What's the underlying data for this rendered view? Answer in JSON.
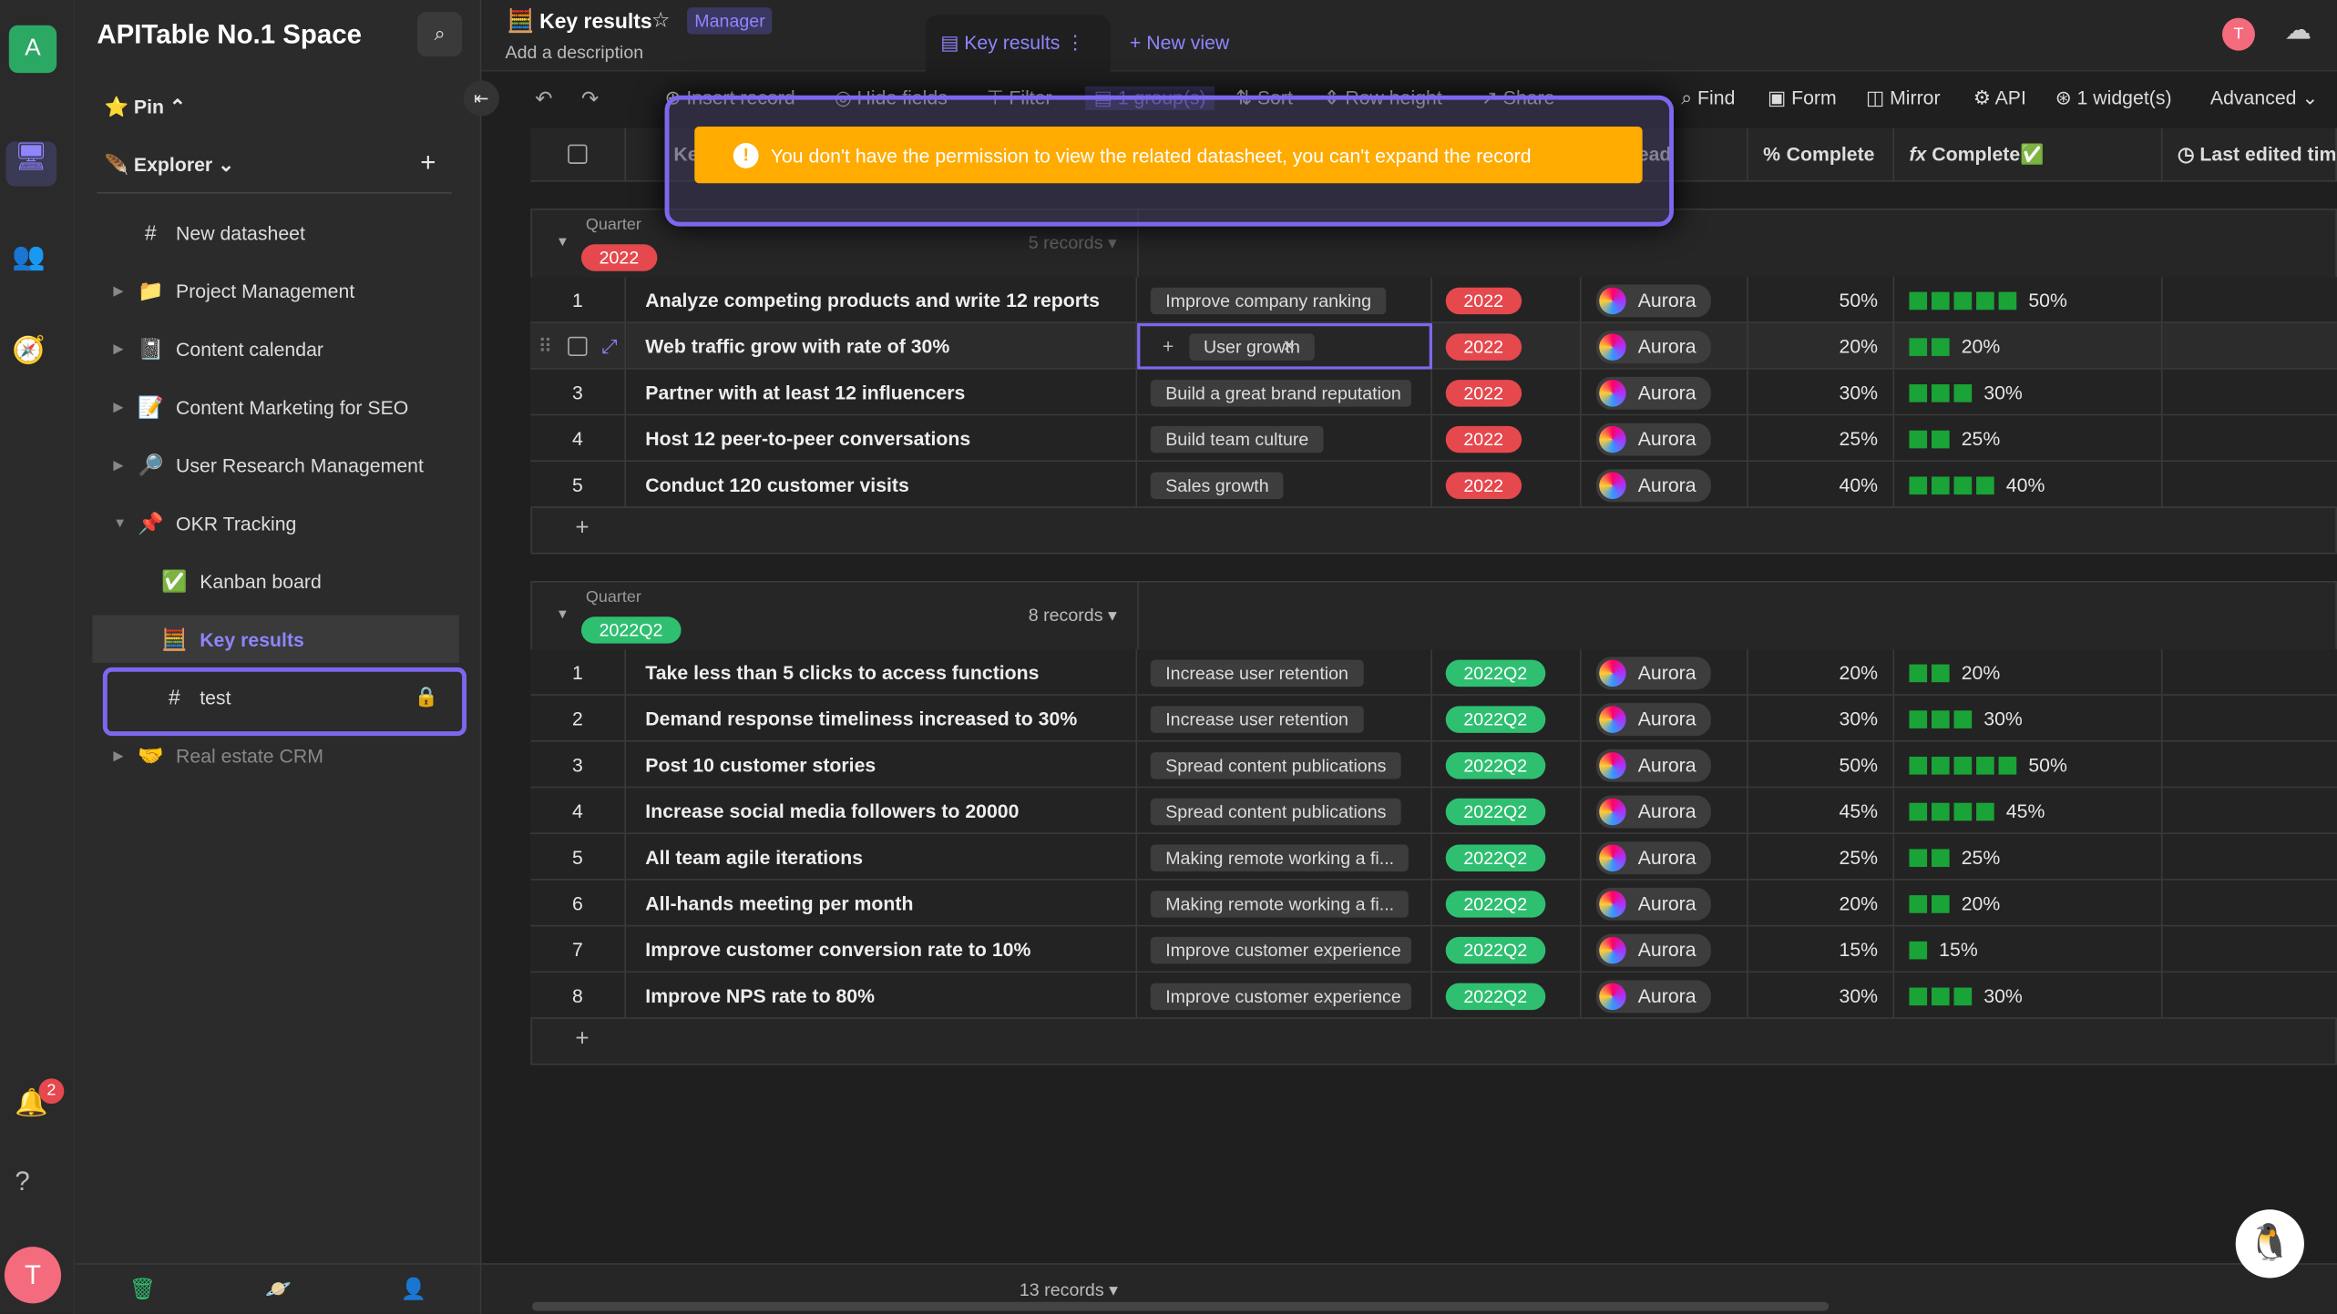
{
  "space": {
    "name": "APITable No.1 Space",
    "avatar": "A",
    "user_avatar": "T",
    "notifications": "2"
  },
  "sidebar": {
    "pin": "Pin",
    "explorer": "Explorer",
    "items": [
      {
        "label": "New datasheet",
        "icon": "#",
        "car": ""
      },
      {
        "label": "Project Management",
        "icon": "📁",
        "car": "▶"
      },
      {
        "label": "Content calendar",
        "icon": "📓",
        "car": "▶"
      },
      {
        "label": "Content Marketing for SEO",
        "icon": "📝",
        "car": "▶"
      },
      {
        "label": "User Research Management",
        "icon": "🔎",
        "car": "▶"
      },
      {
        "label": "OKR Tracking",
        "icon": "📌",
        "car": "▼"
      },
      {
        "label": "Kanban board",
        "icon": "✅",
        "car": ""
      },
      {
        "label": "Key results",
        "icon": "🧮",
        "car": ""
      },
      {
        "label": "test",
        "icon": "#",
        "car": ""
      },
      {
        "label": "Real estate CRM",
        "icon": "🤝",
        "car": "▶"
      }
    ]
  },
  "header": {
    "title": "Key results",
    "role": "Manager",
    "description": "Add a description",
    "view_tab": "Key results",
    "new_view": "+ New view"
  },
  "toolbar": {
    "items": [
      "Insert record",
      "Hide fields",
      "Filter",
      "1 group(s)",
      "Sort",
      "Row height",
      "Share"
    ],
    "right": [
      "Find",
      "Form",
      "Mirror",
      "API",
      "1 widget(s)",
      "Advanced"
    ]
  },
  "toast": {
    "message": "You don't have the permission to view the related datasheet, you can't expand the record",
    "color": "#ffab00"
  },
  "columns": [
    "Ke",
    "ead",
    "Complete",
    "Complete✅",
    "Last edited tim"
  ],
  "groups": [
    {
      "label": "Quarter",
      "value": "2022",
      "count": "5 records",
      "color": "#e5484d",
      "rows": [
        {
          "n": "1",
          "kr": "Analyze competing products and write 12 reports",
          "obj": "Improve company ranking",
          "lead": "Aurora",
          "pct": "50%",
          "bars": 5
        },
        {
          "n": "",
          "kr": "Web traffic grow with rate of 30%",
          "obj": "User growth",
          "lead": "Aurora",
          "pct": "20%",
          "bars": 2
        },
        {
          "n": "3",
          "kr": "Partner with at least 12 influencers",
          "obj": "Build a great brand reputation",
          "lead": "Aurora",
          "pct": "30%",
          "bars": 3
        },
        {
          "n": "4",
          "kr": "Host 12 peer-to-peer conversations",
          "obj": "Build team culture",
          "lead": "Aurora",
          "pct": "25%",
          "bars": 2
        },
        {
          "n": "5",
          "kr": "Conduct 120 customer visits",
          "obj": "Sales growth",
          "lead": "Aurora",
          "pct": "40%",
          "bars": 4
        }
      ]
    },
    {
      "label": "Quarter",
      "value": "2022Q2",
      "count": "8 records",
      "color": "#2fbf71",
      "rows": [
        {
          "n": "1",
          "kr": "Take less than 5 clicks to access functions",
          "obj": "Increase user retention",
          "lead": "Aurora",
          "pct": "20%",
          "bars": 2
        },
        {
          "n": "2",
          "kr": "Demand response timeliness increased to 30%",
          "obj": "Increase user retention",
          "lead": "Aurora",
          "pct": "30%",
          "bars": 3
        },
        {
          "n": "3",
          "kr": "Post 10 customer stories",
          "obj": "Spread content publications",
          "lead": "Aurora",
          "pct": "50%",
          "bars": 5
        },
        {
          "n": "4",
          "kr": "Increase social media followers to 20000",
          "obj": "Spread content publications",
          "lead": "Aurora",
          "pct": "45%",
          "bars": 4
        },
        {
          "n": "5",
          "kr": "All team agile iterations",
          "obj": "Making remote working a fi...",
          "lead": "Aurora",
          "pct": "25%",
          "bars": 2
        },
        {
          "n": "6",
          "kr": "All-hands meeting per month",
          "obj": "Making remote working a fi...",
          "lead": "Aurora",
          "pct": "20%",
          "bars": 2
        },
        {
          "n": "7",
          "kr": "Improve customer conversion rate to 10%",
          "obj": "Improve customer experience",
          "lead": "Aurora",
          "pct": "15%",
          "bars": 1
        },
        {
          "n": "8",
          "kr": "Improve NPS rate to 80%",
          "obj": "Improve customer experience",
          "lead": "Aurora",
          "pct": "30%",
          "bars": 3
        }
      ]
    }
  ],
  "footer": {
    "records": "13 records ▾"
  }
}
